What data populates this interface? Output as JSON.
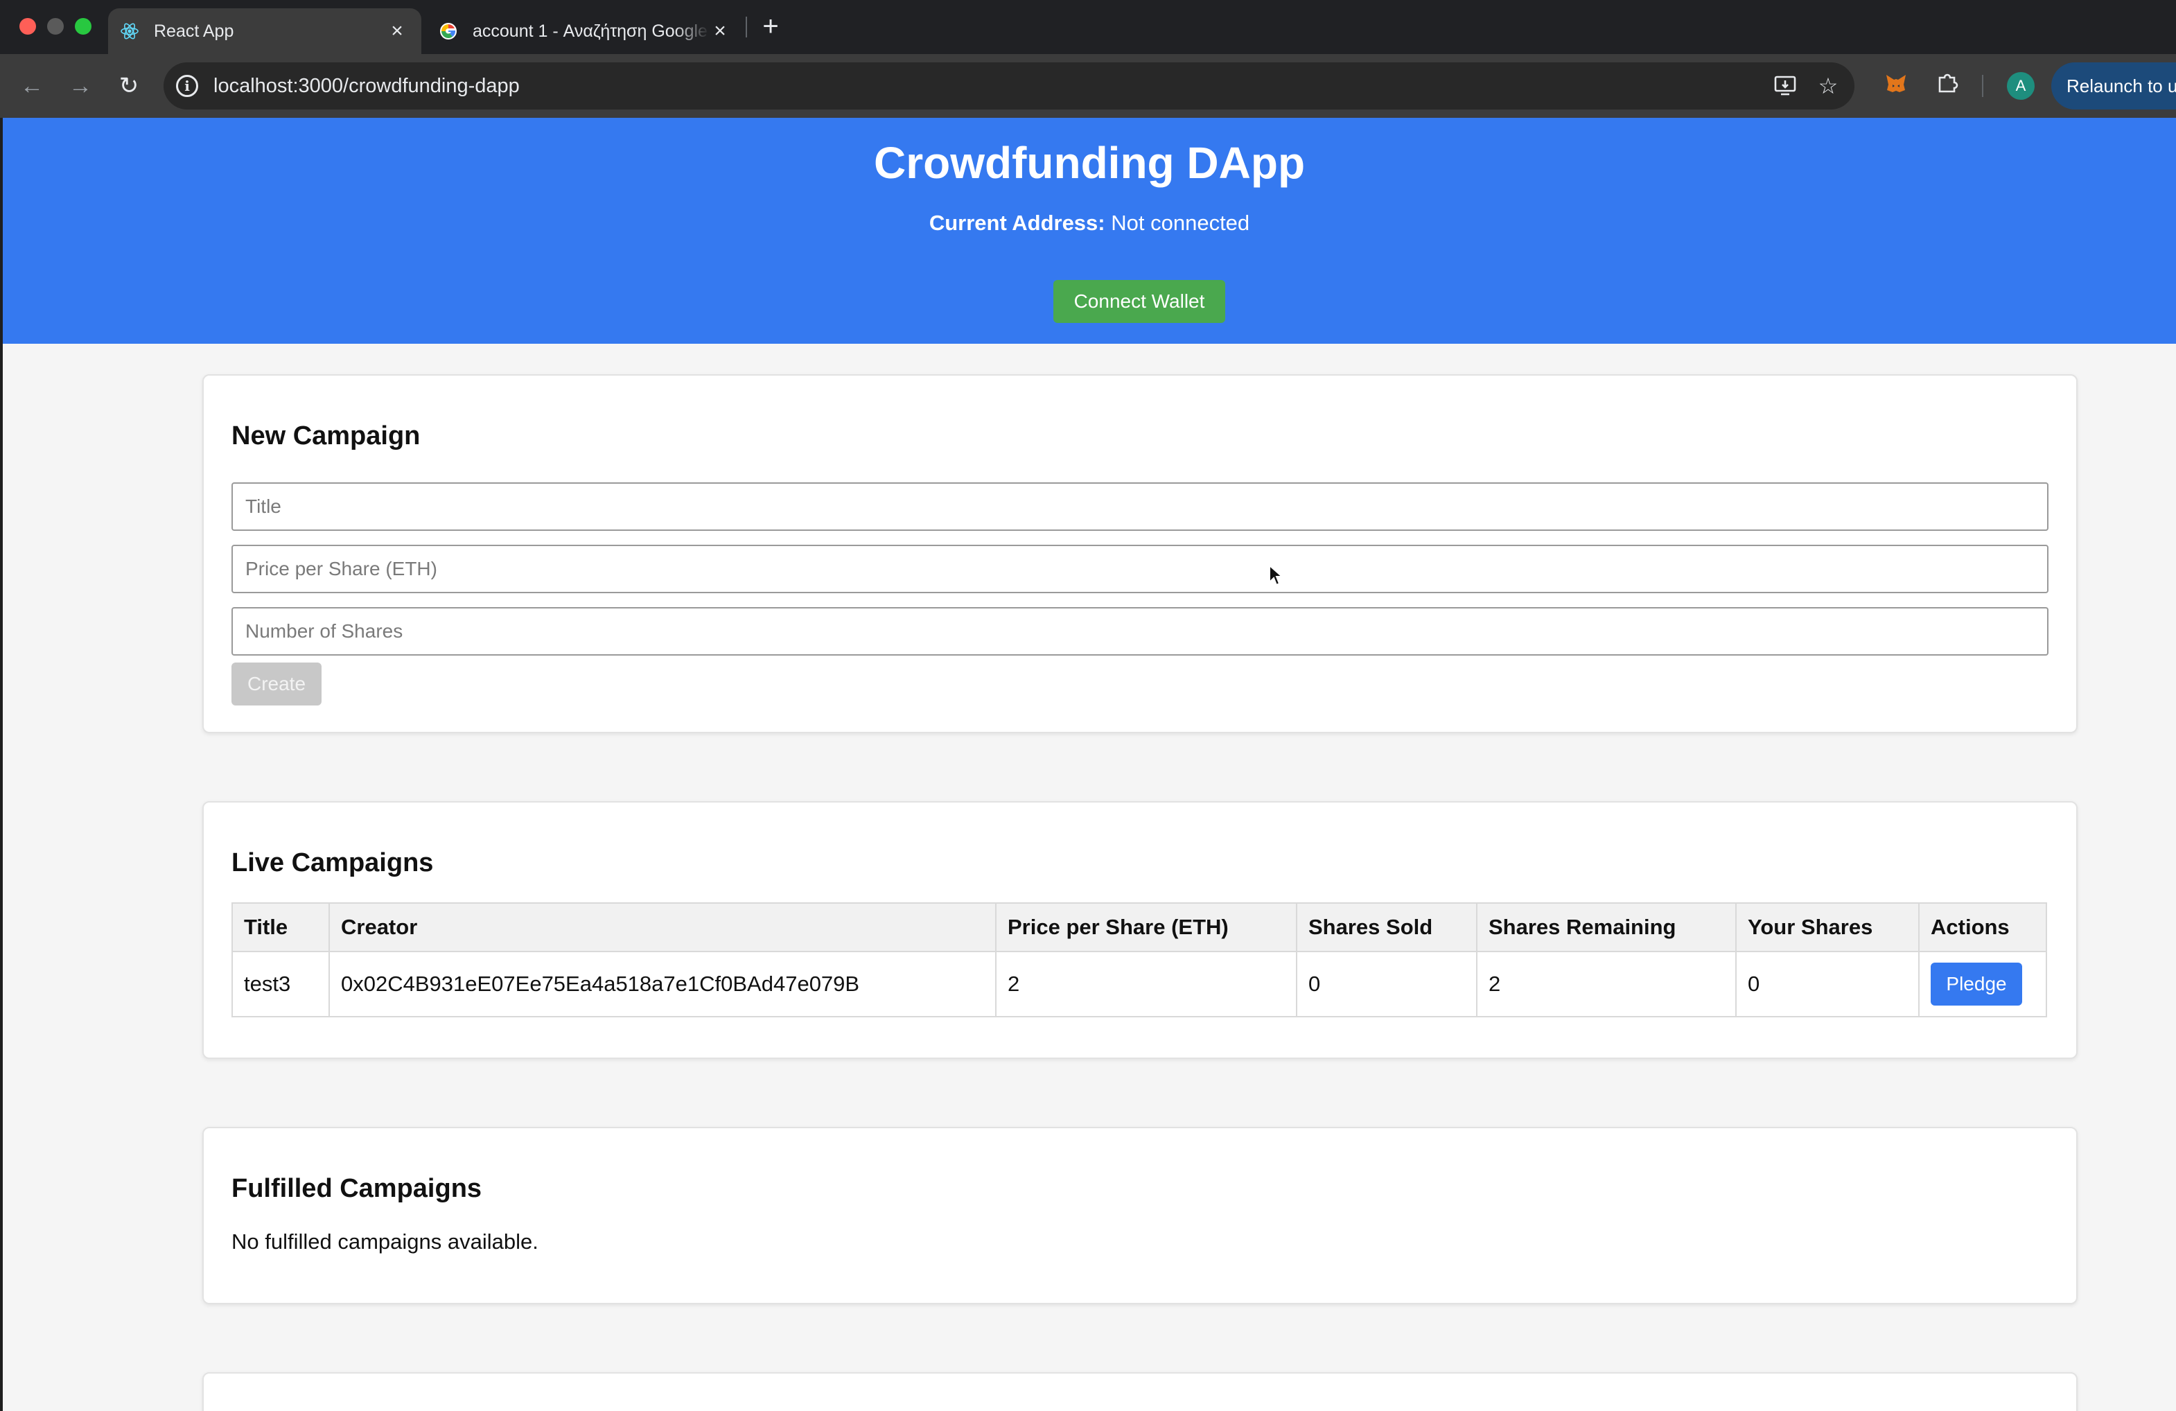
{
  "browser": {
    "tabs": [
      {
        "title": "React App",
        "active": true
      },
      {
        "title": "account 1 - Αναζήτηση Google",
        "active": false
      }
    ],
    "new_tab": "+",
    "url": "localhost:3000/crowdfunding-dapp",
    "relaunch_label": "Relaunch to update",
    "profile_initial": "A",
    "icons": [
      "back-icon",
      "forward-icon",
      "reload-icon",
      "info-icon",
      "install-icon",
      "star-icon",
      "metamask-icon",
      "puzzle-icon"
    ]
  },
  "app": {
    "title": "Crowdfunding DApp",
    "address_label": "Current Address:",
    "address_value": "Not connected",
    "connect_label": "Connect Wallet",
    "colors": {
      "header": "#3579f0",
      "connect": "#4aa84e",
      "pledge": "#3579f0"
    }
  },
  "new_campaign": {
    "heading": "New Campaign",
    "title_placeholder": "Title",
    "price_placeholder": "Price per Share (ETH)",
    "shares_placeholder": "Number of Shares",
    "create_label": "Create"
  },
  "live_campaigns": {
    "heading": "Live Campaigns",
    "columns": [
      "Title",
      "Creator",
      "Price per Share (ETH)",
      "Shares Sold",
      "Shares Remaining",
      "Your Shares",
      "Actions"
    ],
    "rows": [
      {
        "title": "test3",
        "creator": "0x02C4B931eE07Ee75Ea4a518a7e1Cf0BAd47e079B",
        "price": "2",
        "sold": "0",
        "remaining": "2",
        "yours": "0",
        "action": "Pledge"
      }
    ]
  },
  "fulfilled_campaigns": {
    "heading": "Fulfilled Campaigns",
    "empty_message": "No fulfilled campaigns available."
  }
}
